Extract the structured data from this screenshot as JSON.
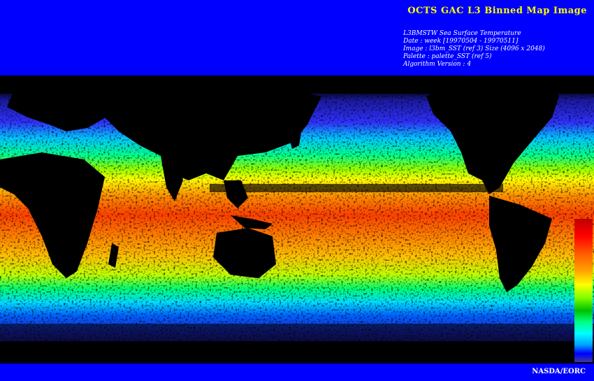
{
  "header": {
    "title": "OCTS GAC L3 Binned Map Image",
    "meta_lines": [
      "L3BMSTW Sea Surface Temperature",
      "Date : week [19970504 - 19970511]",
      "Image : l3bm_SST (ref 3) Size (4096 x 2048)",
      "Palette : palette_SST (ref 5)",
      "Algorithm Version : 4"
    ]
  },
  "footer": {
    "credit": "NASDA/EORC"
  },
  "colors": {
    "banner": "#0000ff",
    "title": "#ffff00",
    "text": "#ffffff",
    "land": "#000000"
  },
  "palette": [
    "#3a3aa0",
    "#0000ff",
    "#00a0ff",
    "#00ffff",
    "#00ff80",
    "#00c000",
    "#80ff00",
    "#ffff00",
    "#ffa000",
    "#ff6000",
    "#ff0000",
    "#c00000"
  ]
}
